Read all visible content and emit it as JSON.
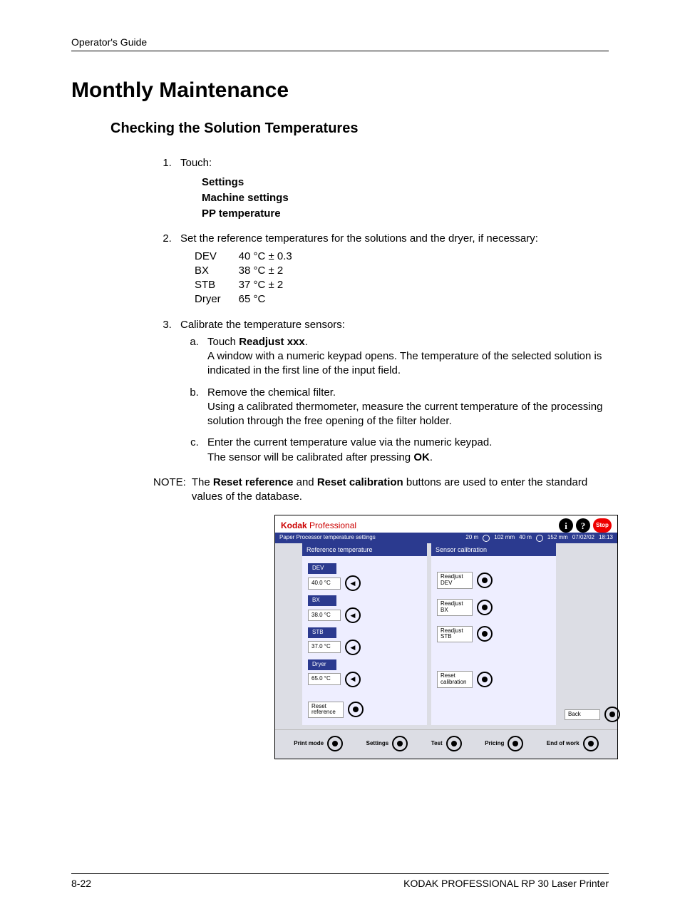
{
  "header": "Operator's Guide",
  "title": "Monthly Maintenance",
  "subtitle": "Checking the Solution Temperatures",
  "step1": {
    "lead": "Touch:",
    "items": [
      "Settings",
      "Machine settings",
      "PP temperature"
    ]
  },
  "step2": {
    "lead": "Set the reference temperatures for the solutions and the dryer, if necessary:",
    "rows": [
      {
        "name": "DEV",
        "val": "40 °C ± 0.3"
      },
      {
        "name": "BX",
        "val": "38 °C ± 2"
      },
      {
        "name": "STB",
        "val": "37 °C ± 2"
      },
      {
        "name": "Dryer",
        "val": "65 °C"
      }
    ]
  },
  "step3": {
    "lead": "Calibrate the temperature sensors:",
    "a": {
      "p1a": "Touch ",
      "p1b": "Readjust xxx",
      "p1c": ".",
      "p2": "A window with a numeric keypad opens. The temperature of the selected solution is indicated in the first line of the input field."
    },
    "b": {
      "p1": "Remove the chemical filter.",
      "p2": "Using a calibrated thermometer, measure the current temperature of the processing solution through the free opening of the filter holder."
    },
    "c": {
      "p1": "Enter the current temperature value via the numeric keypad.",
      "p2a": "The sensor will be calibrated after pressing ",
      "p2b": "OK",
      "p2c": "."
    }
  },
  "note": {
    "label": "NOTE:",
    "t1": "The ",
    "b1": "Reset reference",
    "t2": " and ",
    "b2": "Reset calibration",
    "t3": " buttons are used to enter the standard values of the database."
  },
  "screenshot": {
    "brand1": "Kodak",
    "brand2": " Professional",
    "stop": "Stop",
    "status_title": "Paper Processor temperature settings",
    "status_r1": "20 m",
    "status_r2": "102 mm",
    "status_r3": "40 m",
    "status_r4": "152 mm",
    "status_date": "07/02/02",
    "status_time": "18:13",
    "panelL": "Reference temperature",
    "panelR": "Sensor calibration",
    "ref": [
      {
        "label": "DEV",
        "val": "40.0 °C"
      },
      {
        "label": "BX",
        "val": "38.0 °C"
      },
      {
        "label": "STB",
        "val": "37.0 °C"
      },
      {
        "label": "Dryer",
        "val": "65.0 °C"
      }
    ],
    "readjust": [
      {
        "l1": "Readjust",
        "l2": "DEV"
      },
      {
        "l1": "Readjust",
        "l2": "BX"
      },
      {
        "l1": "Readjust",
        "l2": "STB"
      }
    ],
    "reset_ref_l1": "Reset",
    "reset_ref_l2": "reference",
    "reset_cal_l1": "Reset",
    "reset_cal_l2": "calibration",
    "back": "Back",
    "bottom": [
      "Print mode",
      "Settings",
      "Test",
      "Pricing",
      "End of work"
    ]
  },
  "footer": {
    "left": "8-22",
    "right": "KODAK PROFESSIONAL RP 30 Laser Printer"
  }
}
